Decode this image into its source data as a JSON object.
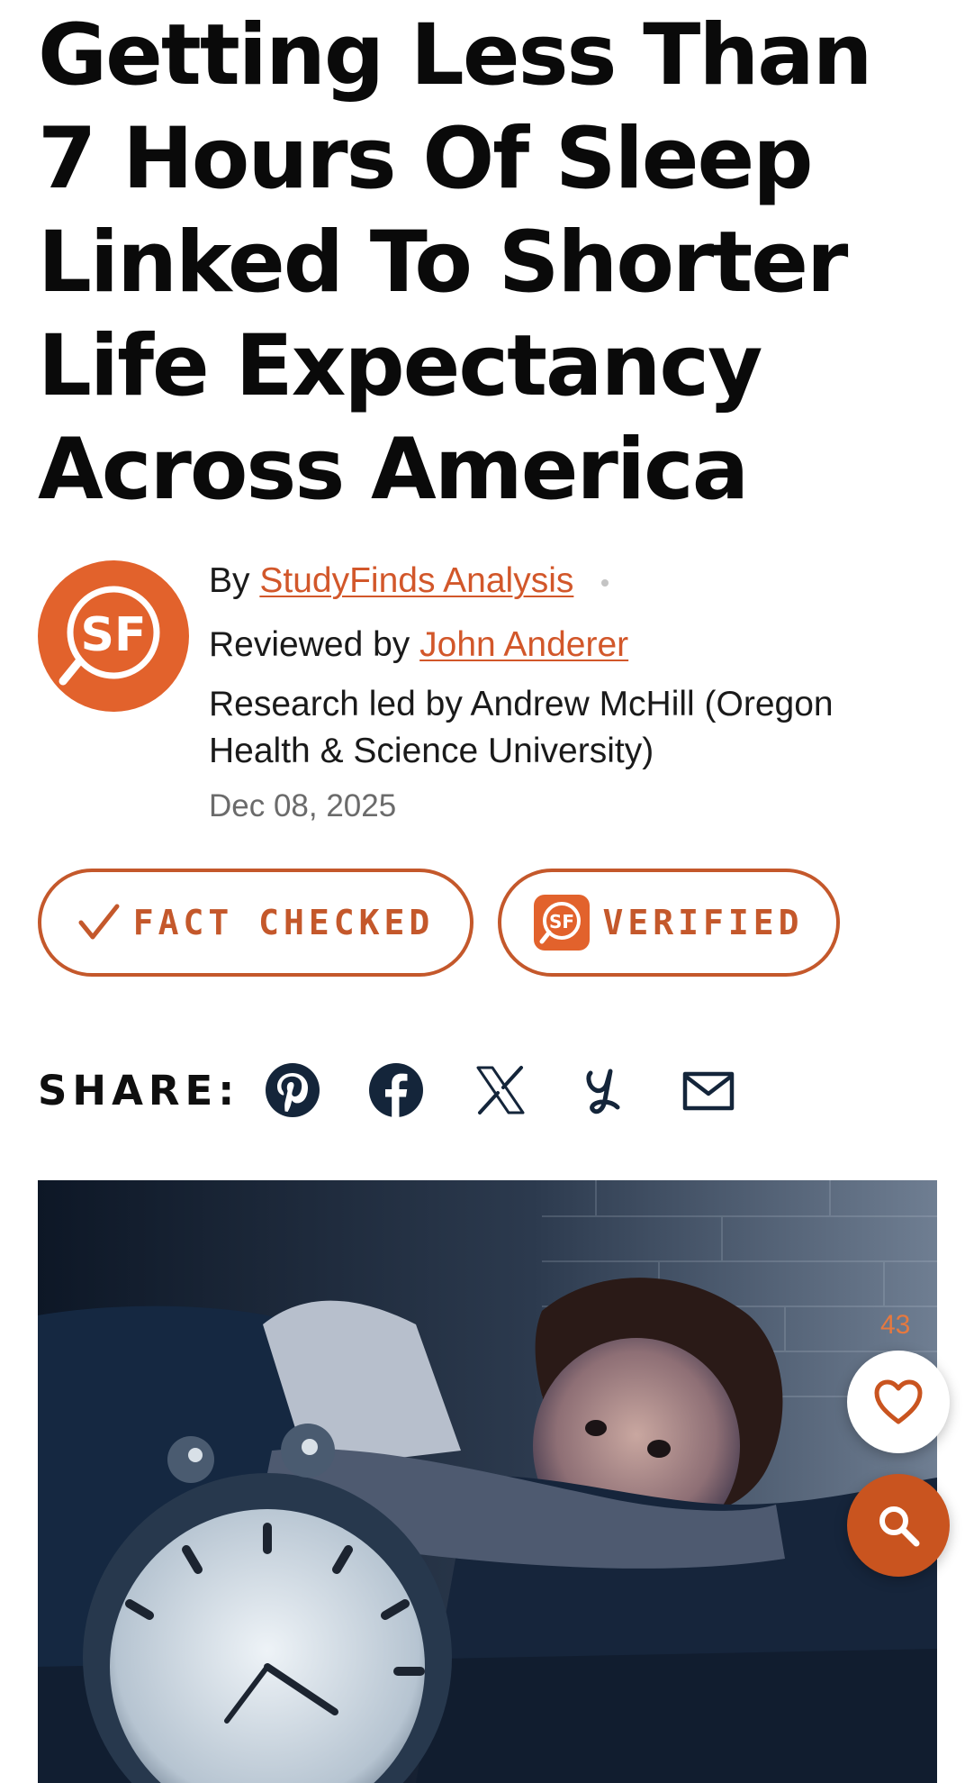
{
  "article": {
    "title": "Getting Less Than 7 Hours Of Sleep Linked To Shorter Life Expectancy Across America",
    "byline": {
      "by_prefix": "By",
      "author": "StudyFinds Analysis",
      "reviewed_prefix": "Reviewed by",
      "reviewer": "John Anderer",
      "research_credit": "Research led by Andrew McHill (Oregon Health & Science University)",
      "date": "Dec 08, 2025"
    },
    "logo": {
      "text": "SF",
      "color": "#e2622c"
    },
    "badges": {
      "fact_checked": "FACT CHECKED",
      "verified": "VERIFIED"
    }
  },
  "share": {
    "label": "SHARE:",
    "icons": [
      "pinterest-icon",
      "facebook-icon",
      "x-icon",
      "yummly-icon",
      "email-icon"
    ]
  },
  "floating": {
    "like_count": "43",
    "like_icon": "heart-icon",
    "search_icon": "search-icon"
  },
  "theme": {
    "accent": "#c4582b",
    "icon_color": "#14253a"
  }
}
